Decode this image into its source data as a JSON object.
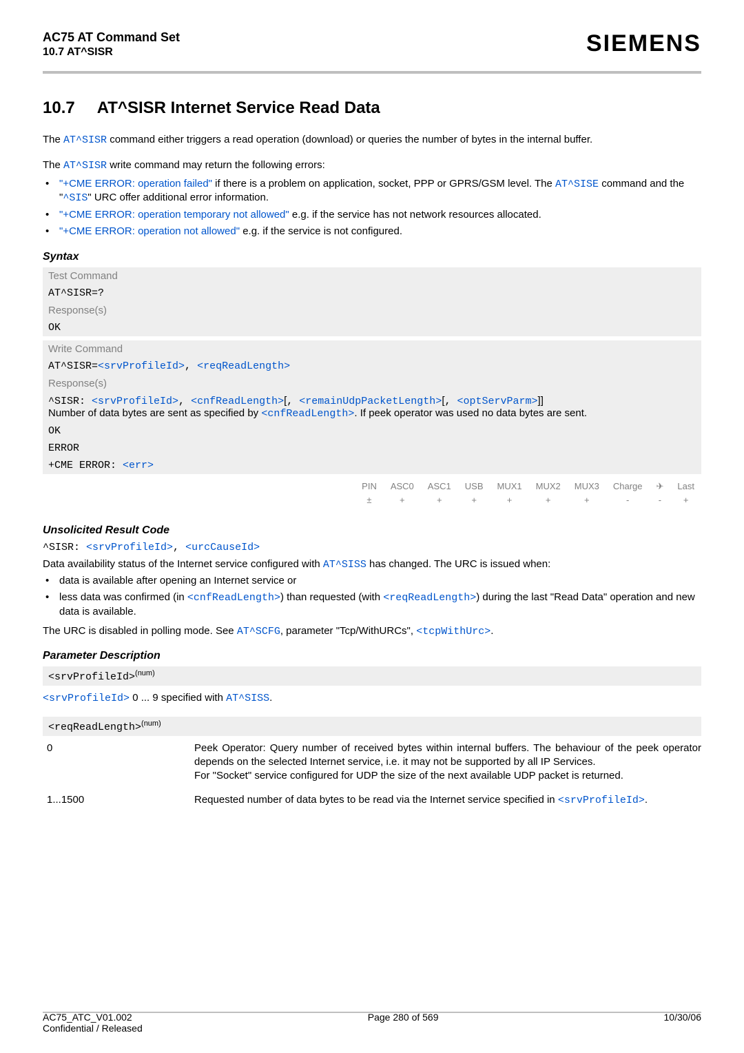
{
  "header": {
    "doc_title": "AC75 AT Command Set",
    "doc_sub": "10.7 AT^SISR",
    "brand": "SIEMENS"
  },
  "section": {
    "number": "10.7",
    "title": "AT^SISR   Internet Service Read Data"
  },
  "intro": {
    "p1_pre": "The ",
    "p1_cmd": "AT^SISR",
    "p1_post": " command either triggers a read operation (download) or queries the number of bytes in the internal buffer.",
    "p2_pre": "The ",
    "p2_cmd": "AT^SISR",
    "p2_post": " write command may return the following errors:",
    "b1_err": "\"+CME ERROR: operation failed\"",
    "b1_mid": " if there is a problem on application, socket, PPP or GPRS/GSM level. The ",
    "b1_cmd": "AT^SISE",
    "b1_mid2": " command and the \"",
    "b1_urc": "^SIS",
    "b1_post": "\" URC offer additional error information.",
    "b2_err": "\"+CME ERROR: operation temporary not allowed\"",
    "b2_post": " e.g. if the service has not network resources allocated.",
    "b3_err": "\"+CME ERROR: operation not allowed\"",
    "b3_post": " e.g. if the service is not configured."
  },
  "syntax": {
    "label": "Syntax",
    "test_lbl": "Test Command",
    "test_cmd": "AT^SISR=?",
    "resp_lbl": "Response(s)",
    "ok": "OK",
    "write_lbl": "Write Command",
    "write_pre": "AT^SISR=",
    "write_a1": "<srvProfileId>",
    "write_sep": ", ",
    "write_a2": "<reqReadLength>",
    "line_pre": "^SISR: ",
    "la1": "<srvProfileId>",
    "sep": ", ",
    "la2": "<cnfReadLength>",
    "lb1": "[",
    "la3": "<remainUdpPacketLength>",
    "lb2": "[",
    "la4": "<optServParm>",
    "lb3": "]]",
    "expl_pre": "Number of data bytes are sent as specified by ",
    "expl_arg": "<cnfReadLength>",
    "expl_post": ". If peek operator was used no data bytes are sent.",
    "err": "ERROR",
    "cme_pre": "+CME ERROR: ",
    "cme_arg": "<err>"
  },
  "compat": {
    "cols": [
      "PIN",
      "ASC0",
      "ASC1",
      "USB",
      "MUX1",
      "MUX2",
      "MUX3",
      "Charge",
      "✈",
      "Last"
    ],
    "vals": [
      "±",
      "+",
      "+",
      "+",
      "+",
      "+",
      "+",
      "-",
      "-",
      "+"
    ]
  },
  "urc": {
    "title": "Unsolicited Result Code",
    "line_pre": "^SISR: ",
    "a1": "<srvProfileId>",
    "sep": ", ",
    "a2": "<urcCauseId>",
    "p_pre": "Data availability status of the Internet service configured with ",
    "p_cmd": "AT^SISS",
    "p_post": " has changed. The URC is issued when:",
    "b1": "data is available after opening an Internet service or",
    "b2_pre": "less data was confirmed (in ",
    "b2_a1": "<cnfReadLength>",
    "b2_mid": ") than requested (with ",
    "b2_a2": "<reqReadLength>",
    "b2_post": ") during the last \"Read Data\" operation and new data is available.",
    "p2_pre": "The URC is disabled in polling mode. See ",
    "p2_cmd": "AT^SCFG",
    "p2_mid": ", parameter \"Tcp/WithURCs\", ",
    "p2_arg": "<tcpWithUrc>",
    "p2_post": "."
  },
  "params": {
    "title": "Parameter Description",
    "srv_head": "<srvProfileId>",
    "srv_sup": "(num)",
    "srv_line_a": "<srvProfileId>",
    "srv_line_mid": " 0 ... 9 specified with ",
    "srv_line_cmd": "AT^SISS",
    "srv_line_post": ".",
    "req_head": "<reqReadLength>",
    "req_sup": "(num)",
    "v0": "0",
    "v0_desc": "Peek Operator: Query number of received bytes within internal buffers. The behaviour of the peek operator depends on the selected Internet service, i.e. it may not be supported by all IP Services.\nFor \"Socket\" service configured for UDP the size of the next available UDP packet is returned.",
    "v1": "1...1500",
    "v1_desc_pre": "Requested number of data bytes to be read via the Internet service specified in ",
    "v1_arg": "<srvProfileId>",
    "v1_desc_post": "."
  },
  "footer": {
    "left1": "AC75_ATC_V01.002",
    "left2": "Confidential / Released",
    "center": "Page 280 of 569",
    "right": "10/30/06"
  }
}
